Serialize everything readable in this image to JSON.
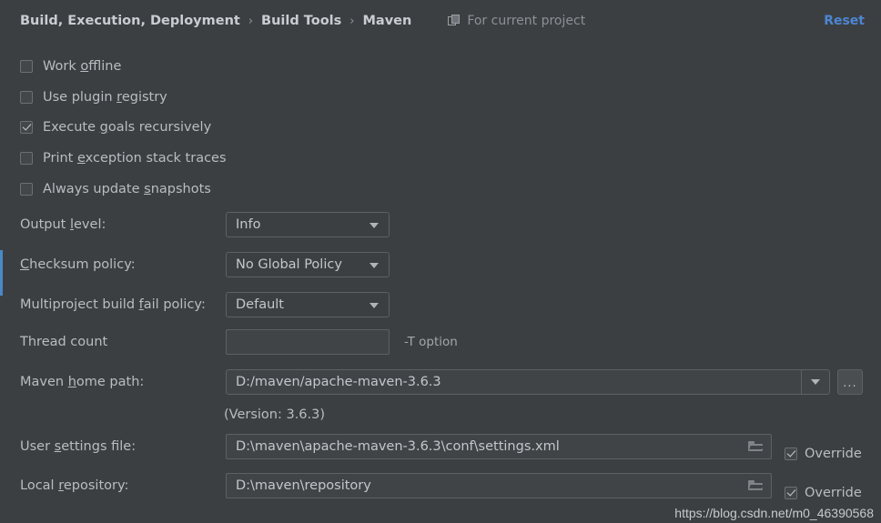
{
  "header": {
    "breadcrumb": [
      "Build, Execution, Deployment",
      "Build Tools",
      "Maven"
    ],
    "separator": "›",
    "scope_icon": "layers-icon",
    "scope_label": "For current project",
    "reset_label": "Reset",
    "reset_color": "#4d86d4"
  },
  "accent_color": "#4a88c7",
  "checkboxes": [
    {
      "label_pre": "Work ",
      "mnemonic": "o",
      "label_post": "ffline",
      "checked": false
    },
    {
      "label_pre": "Use plugin ",
      "mnemonic": "r",
      "label_post": "egistry",
      "checked": false
    },
    {
      "label_pre": "Execute ",
      "mnemonic": "g",
      "label_post": "oals recursively",
      "checked": true
    },
    {
      "label_pre": "Print ",
      "mnemonic": "e",
      "label_post": "xception stack traces",
      "checked": false
    },
    {
      "label_pre": "Always update ",
      "mnemonic": "s",
      "label_post": "napshots",
      "checked": false
    }
  ],
  "dropdowns": [
    {
      "label_pre": "Output ",
      "mnemonic": "l",
      "label_post": "evel:",
      "value": "Info"
    },
    {
      "label_pre": "",
      "mnemonic": "C",
      "label_post": "hecksum policy:",
      "value": "No Global Policy"
    },
    {
      "label_pre": "Multiproject build ",
      "mnemonic": "f",
      "label_post": "ail policy:",
      "value": "Default"
    }
  ],
  "thread_count": {
    "label": "Thread count",
    "value": "",
    "hint": "-T option"
  },
  "maven_home": {
    "label_pre": "Maven ",
    "mnemonic": "h",
    "label_post": "ome path:",
    "value": "D:/maven/apache-maven-3.6.3",
    "browse_label": "...",
    "version_note": "(Version: 3.6.3)"
  },
  "user_settings": {
    "label_pre": "User ",
    "mnemonic": "s",
    "label_post": "ettings file:",
    "value": "D:\\maven\\apache-maven-3.6.3\\conf\\settings.xml",
    "browse_icon": "folder-icon",
    "override_label": "Override",
    "override_checked": true
  },
  "local_repository": {
    "label_pre": "Local ",
    "mnemonic": "r",
    "label_post": "epository:",
    "value": "D:\\maven\\repository",
    "browse_icon": "folder-icon",
    "override_label": "Override",
    "override_checked": true
  },
  "watermark": "https://blog.csdn.net/m0_46390568"
}
